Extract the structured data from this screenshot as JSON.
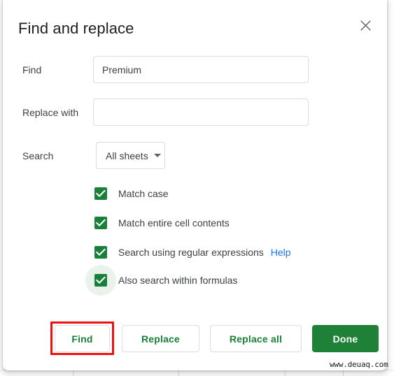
{
  "dialog": {
    "title": "Find and replace",
    "close_icon": "close-icon"
  },
  "fields": {
    "find": {
      "label": "Find",
      "value": "Premium",
      "placeholder": ""
    },
    "replace": {
      "label": "Replace with",
      "value": "",
      "placeholder": ""
    },
    "search": {
      "label": "Search",
      "selected": "All sheets",
      "options": [
        "All sheets"
      ]
    }
  },
  "checkboxes": [
    {
      "label": "Match case",
      "checked": true,
      "help": null
    },
    {
      "label": "Match entire cell contents",
      "checked": true,
      "help": null
    },
    {
      "label": "Search using regular expressions",
      "checked": true,
      "help": "Help"
    },
    {
      "label": "Also search within formulas",
      "checked": true,
      "help": null
    }
  ],
  "buttons": {
    "find": "Find",
    "replace": "Replace",
    "replace_all": "Replace all",
    "done": "Done"
  },
  "watermark": "www.deuaq.com",
  "colors": {
    "accent_green": "#188038",
    "done_green": "#1e8137",
    "link_blue": "#1a73e8",
    "highlight_red": "#ee1111",
    "text": "#3c4043",
    "title_text": "#202124",
    "border": "#dadce0"
  }
}
